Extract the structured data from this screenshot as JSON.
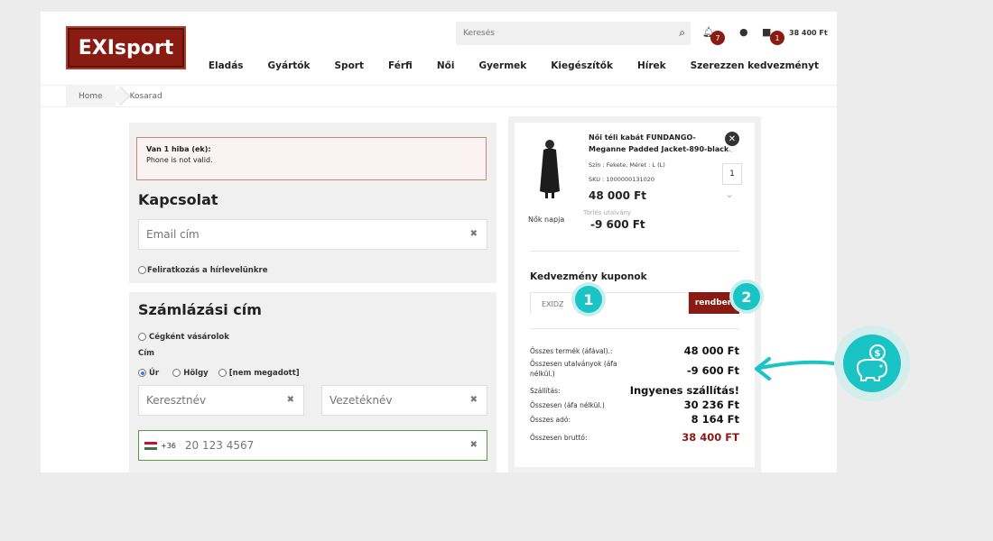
{
  "brand": {
    "logo_text": "EXIsport",
    "accent": "#8a1b12",
    "teal": "#1bc4c4"
  },
  "header": {
    "search_placeholder": "Keresés",
    "notifications_count": "7",
    "cart_count": "1",
    "cart_total": "38 400 Ft"
  },
  "nav": [
    "Eladás",
    "Gyártók",
    "Sport",
    "Férfi",
    "Női",
    "Gyermek",
    "Kiegészítők",
    "Hírek",
    "Szerezzen kedvezményt"
  ],
  "breadcrumb": {
    "home": "Home",
    "current": "Kosarad"
  },
  "error": {
    "title": "Van 1 hiba (ek):",
    "message": "Phone is not valid."
  },
  "contact": {
    "title": "Kapcsolat",
    "email_placeholder": "Email cím",
    "newsletter_label": "Feliratkozás a hírlevelünkre"
  },
  "billing": {
    "title": "Számlázási cím",
    "company_label": "Cégként vásárolok",
    "salutation_label": "Cím",
    "salutations": [
      "Úr",
      "Hölgy",
      "[nem megadott]"
    ],
    "firstname_placeholder": "Keresztnév",
    "lastname_placeholder": "Vezetéknév",
    "phone_prefix": "+36",
    "phone_placeholder": "20 123 4567"
  },
  "cart_item": {
    "name": "Női téli kabát FUNDANGO-Meganne Padded Jacket-890-black",
    "attributes": "Szín : Fekete, Méret : L (L)",
    "sku": "SKU : 1000000131020",
    "price": "48 000 Ft",
    "campaign": "Nők napja",
    "voucher_label": "Törlés utalvány",
    "voucher_value": "-9 600 Ft",
    "quantity": "1"
  },
  "coupon": {
    "title": "Kedvezmény kuponok",
    "placeholder": "EXIDZ",
    "button": "rendben"
  },
  "summary": {
    "products_label": "Összes termék (áfával).:",
    "products_value": "48 000 Ft",
    "vouchers_label": "Összesen utalványok (áfa nélkül.)",
    "vouchers_value": "-9 600 Ft",
    "shipping_label": "Szállítás:",
    "shipping_value": "Ingyenes szállítás!",
    "net_label": "Összesen (áfa nélkül.)",
    "net_value": "30 236 Ft",
    "tax_label": "Összes adó:",
    "tax_value": "8 164 Ft",
    "gross_label": "Összesen bruttó:",
    "gross_value": "38 400 FT"
  },
  "steps": [
    "1",
    "2"
  ]
}
